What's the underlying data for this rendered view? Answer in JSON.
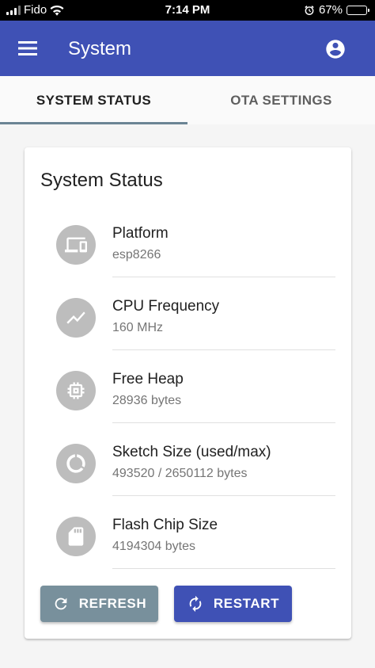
{
  "status_bar": {
    "carrier": "Fido",
    "time": "7:14 PM",
    "battery": "67%",
    "battery_level": 0.67
  },
  "app_bar": {
    "title": "System",
    "menu_icon": "menu-icon",
    "account_icon": "account-circle-icon",
    "color": "#3f51b5"
  },
  "tabs": [
    {
      "label": "SYSTEM STATUS",
      "active": true
    },
    {
      "label": "OTA SETTINGS",
      "active": false
    }
  ],
  "card": {
    "title": "System Status",
    "items": [
      {
        "icon": "devices-icon",
        "primary": "Platform",
        "secondary": "esp8266"
      },
      {
        "icon": "show-chart-icon",
        "primary": "CPU Frequency",
        "secondary": "160 MHz"
      },
      {
        "icon": "memory-icon",
        "primary": "Free Heap",
        "secondary": "28936 bytes"
      },
      {
        "icon": "data-usage-icon",
        "primary": "Sketch Size (used/max)",
        "secondary": "493520 / 2650112 bytes"
      },
      {
        "icon": "sd-storage-icon",
        "primary": "Flash Chip Size",
        "secondary": "4194304 bytes"
      }
    ],
    "buttons": {
      "refresh": {
        "label": "REFRESH",
        "icon": "refresh-icon",
        "color": "#78909c"
      },
      "restart": {
        "label": "RESTART",
        "icon": "autorenew-icon",
        "color": "#3f51b5"
      }
    }
  }
}
